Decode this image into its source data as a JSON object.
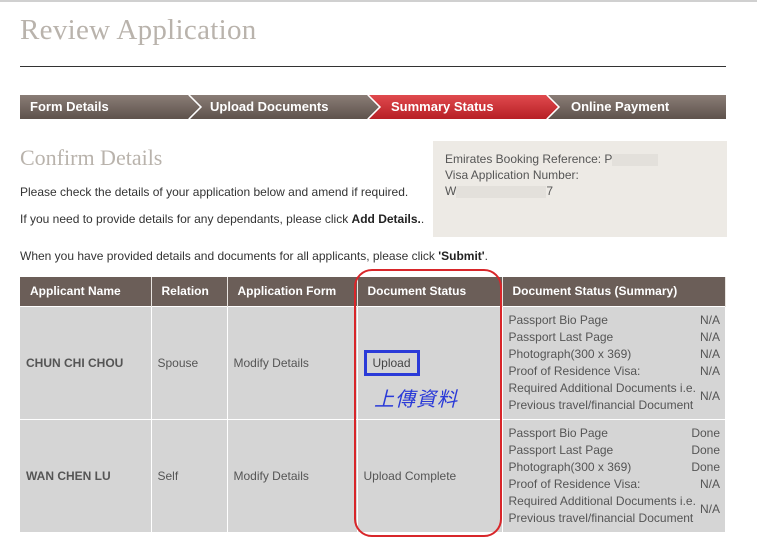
{
  "page": {
    "title": "Review Application"
  },
  "steps": [
    {
      "label": "Form Details",
      "state": "done"
    },
    {
      "label": "Upload Documents",
      "state": "done"
    },
    {
      "label": "Summary Status",
      "state": "active"
    },
    {
      "label": "Online Payment",
      "state": "pending"
    }
  ],
  "colors": {
    "step_done": "#6b5e58",
    "step_active": "#c8262c",
    "header_bg": "#6b5e58",
    "annotation_red": "#d8262a",
    "annotation_blue": "#2a3ad8"
  },
  "confirm": {
    "title": "Confirm Details",
    "line1": "Please check the details of your application below and amend if required.",
    "line2_pre": "If you need to provide details for any dependants, please click ",
    "line2_bold": "Add Details.",
    "line2_post": ".",
    "line3_pre": "When you have provided details and documents for all applicants, please click ",
    "line3_bold": "'Submit'",
    "line3_post": "."
  },
  "reference": {
    "booking_label": "Emirates Booking Reference: P",
    "visa_label": "Visa Application Number:",
    "visa_prefix": "W",
    "visa_suffix": "7"
  },
  "table": {
    "headers": [
      "Applicant Name",
      "Relation",
      "Application Form",
      "Document Status",
      "Document Status (Summary)"
    ],
    "rows": [
      {
        "name": "CHUN CHI CHOU",
        "relation": "Spouse",
        "form": "Modify Details",
        "doc_status": "Upload",
        "summary": [
          {
            "label": "Passport Bio Page",
            "value": "N/A"
          },
          {
            "label": "Passport Last Page",
            "value": "N/A"
          },
          {
            "label": "Photograph(300 x 369)",
            "value": "N/A"
          },
          {
            "label": "Proof of Residence Visa:",
            "value": "N/A"
          },
          {
            "label": "Required Additional Documents i.e.",
            "label2": "Previous travel/financial Document",
            "value": "N/A"
          }
        ]
      },
      {
        "name": "WAN CHEN LU",
        "relation": "Self",
        "form": "Modify Details",
        "doc_status": "Upload Complete",
        "summary": [
          {
            "label": "Passport Bio Page",
            "value": "Done"
          },
          {
            "label": "Passport Last Page",
            "value": "Done"
          },
          {
            "label": "Photograph(300 x 369)",
            "value": "Done"
          },
          {
            "label": "Proof of Residence Visa:",
            "value": "N/A"
          },
          {
            "label": "Required Additional Documents i.e.",
            "label2": "Previous travel/financial Document",
            "value": "N/A"
          }
        ]
      }
    ]
  },
  "annotation": {
    "text": "上傳資料"
  }
}
